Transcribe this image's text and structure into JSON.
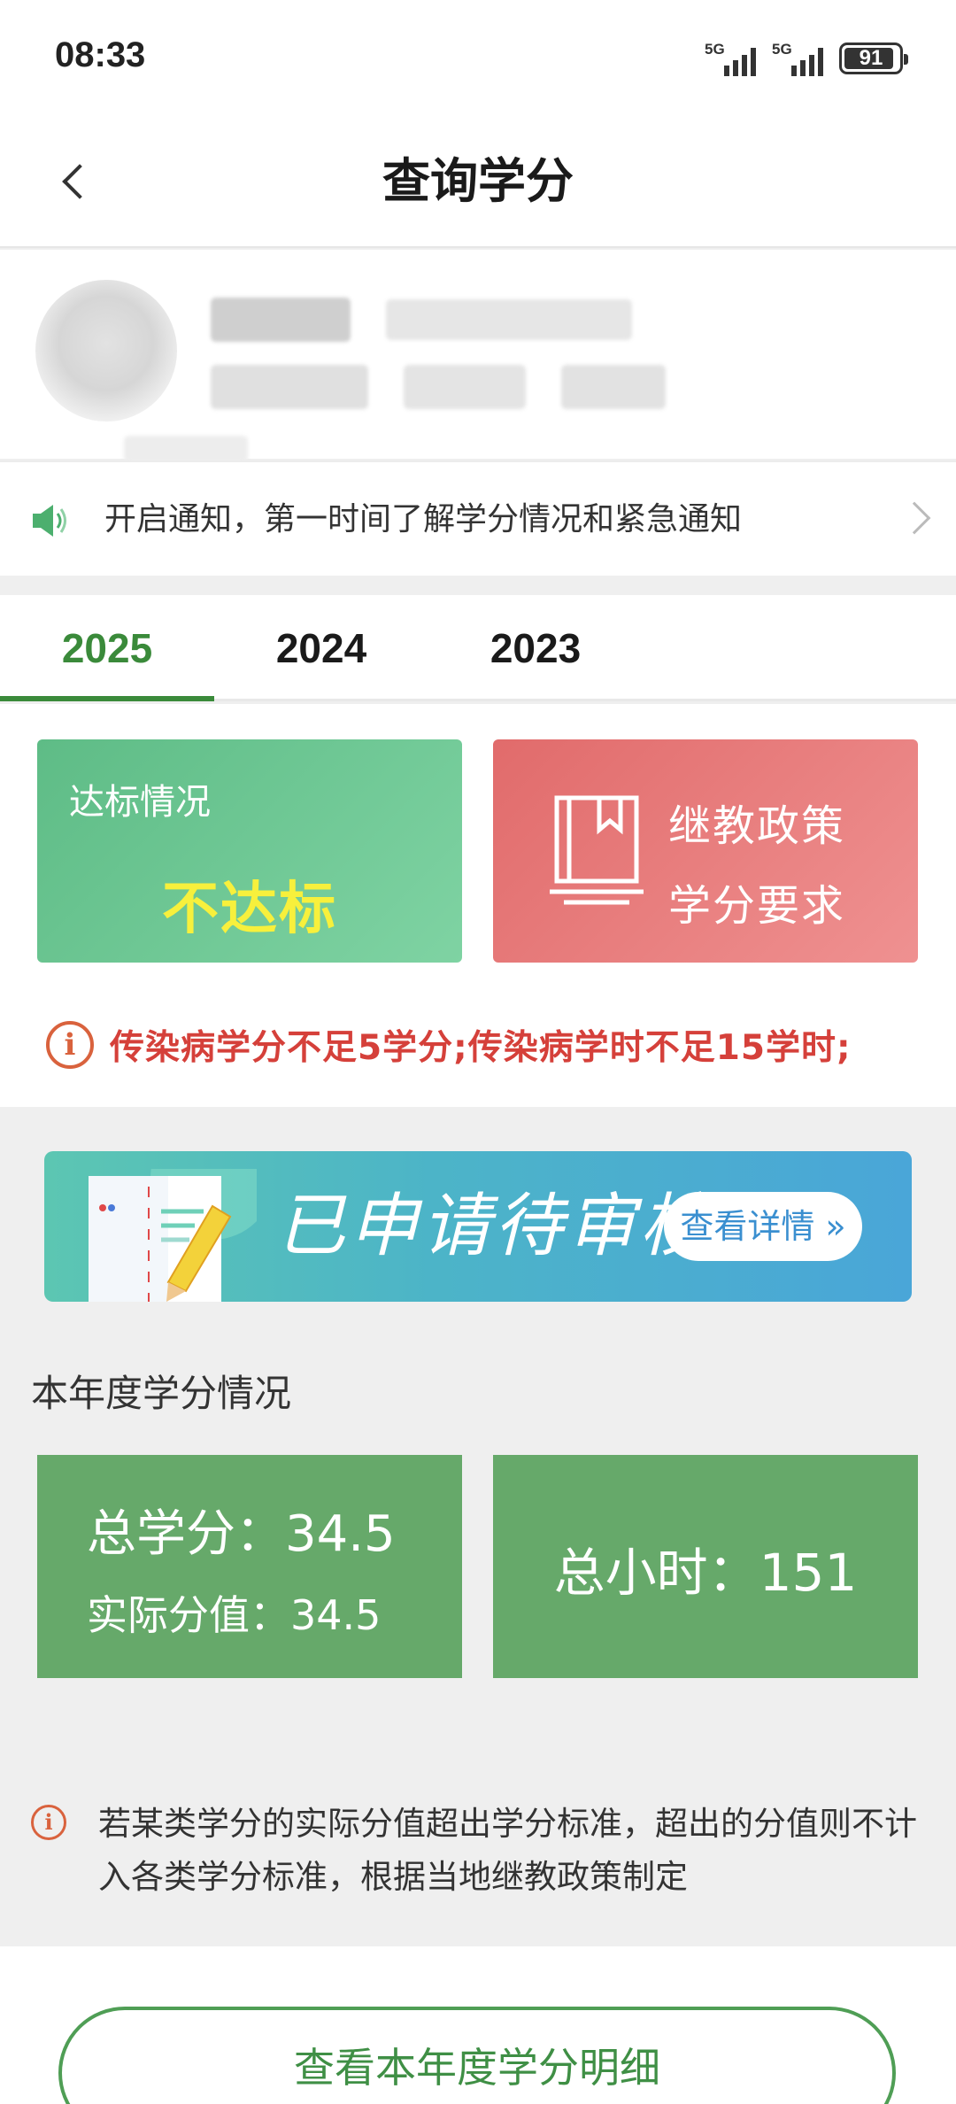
{
  "status_bar": {
    "time": "08:33",
    "network_1": "5G",
    "network_2": "5G",
    "battery": "91",
    "battery_level": 0.91
  },
  "header": {
    "title": "查询学分",
    "back_icon": "chevron-left-icon"
  },
  "notification": {
    "icon": "speaker-icon",
    "text": "开启通知，第一时间了解学分情况和紧急通知",
    "accent": "#4caf6e"
  },
  "year_tabs": [
    "2025",
    "2024",
    "2023"
  ],
  "active_year": "2025",
  "compliance": {
    "label": "达标情况",
    "value": "不达标",
    "card_color": "#6cc494",
    "value_color": "#f7f03c"
  },
  "policy_card": {
    "line1": "继教政策",
    "line2": "学分要求",
    "icon": "book-icon",
    "card_color": "#e77c7c"
  },
  "warning": {
    "icon": "info-icon",
    "text": "传染病学分不足5学分;传染病学时不足15学时;",
    "color": "#d5403a"
  },
  "banner": {
    "title": "已申请待审核",
    "button": "查看详情 »"
  },
  "section_title": "本年度学分情况",
  "credits": {
    "total_label": "总学分：34.5",
    "actual_label": "实际分值：34.5",
    "hours_label": "总小时：151",
    "card_color": "#66a96a"
  },
  "note": {
    "icon": "info-icon",
    "text": "若某类学分的实际分值超出学分标准，超出的分值则不计入各类学分标准，根据当地继教政策制定"
  },
  "detail_button": "查看本年度学分明细"
}
